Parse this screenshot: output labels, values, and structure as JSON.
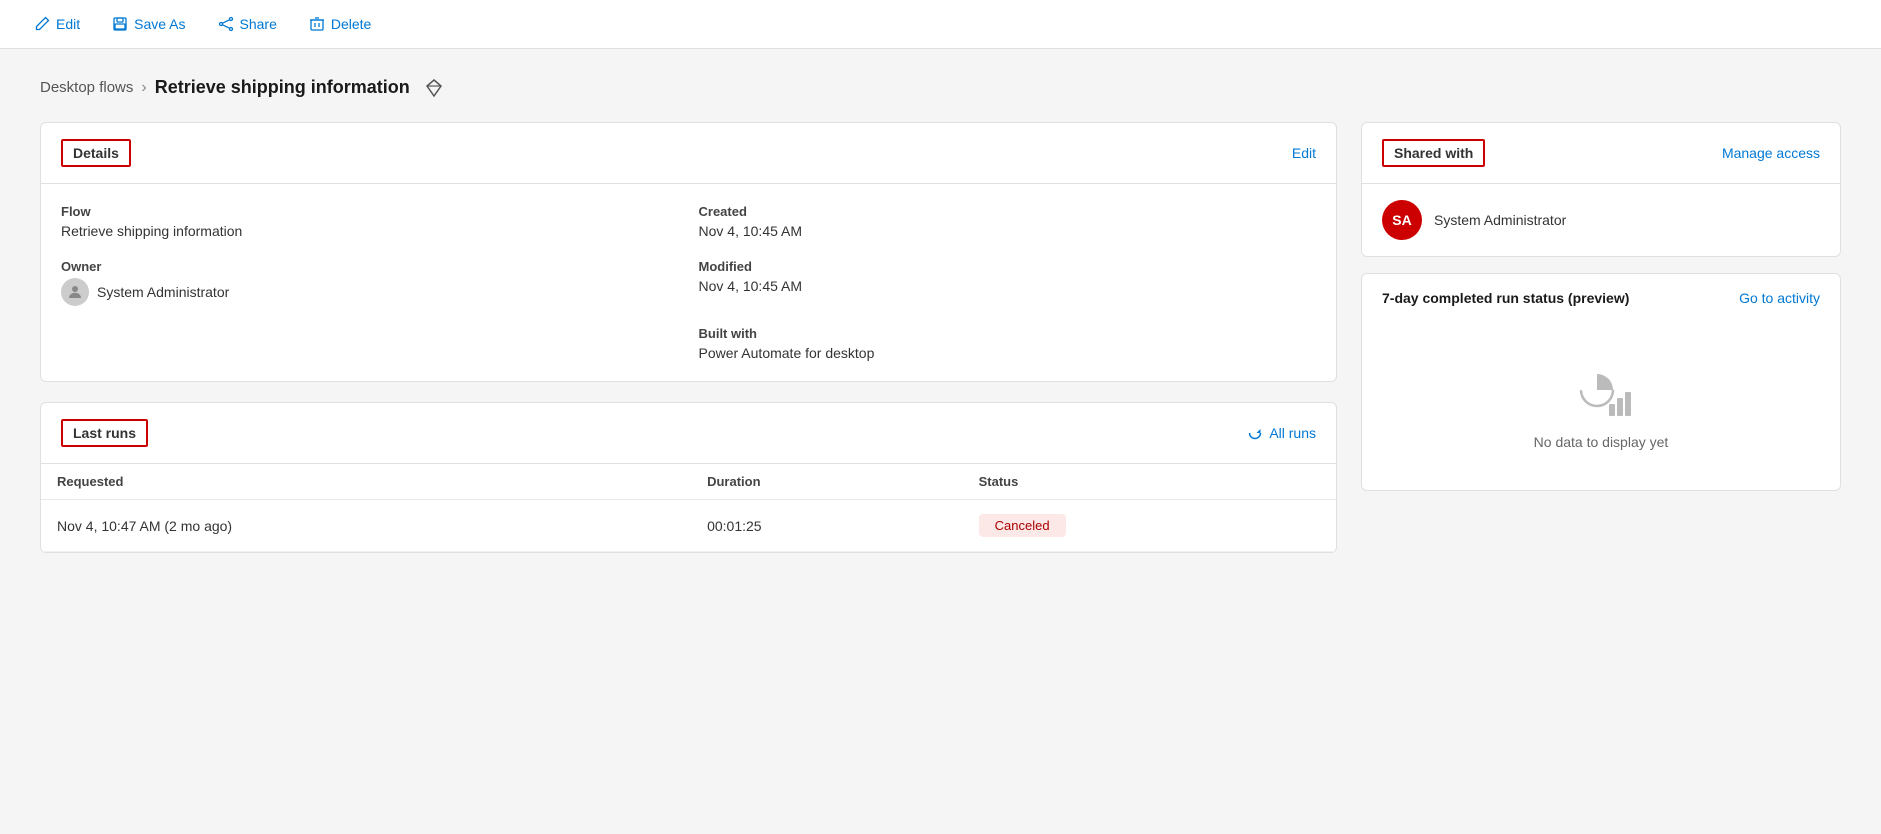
{
  "toolbar": {
    "edit_label": "Edit",
    "save_as_label": "Save As",
    "share_label": "Share",
    "delete_label": "Delete"
  },
  "breadcrumb": {
    "parent_label": "Desktop flows",
    "separator": ">",
    "current_label": "Retrieve shipping information"
  },
  "details_card": {
    "title": "Details",
    "edit_label": "Edit",
    "flow_label": "Flow",
    "flow_value": "Retrieve shipping information",
    "owner_label": "Owner",
    "owner_value": "System Administrator",
    "created_label": "Created",
    "created_value": "Nov 4, 10:45 AM",
    "modified_label": "Modified",
    "modified_value": "Nov 4, 10:45 AM",
    "built_with_label": "Built with",
    "built_with_value": "Power Automate for desktop"
  },
  "last_runs_card": {
    "title": "Last runs",
    "all_runs_label": "All runs",
    "columns": {
      "requested": "Requested",
      "duration": "Duration",
      "status": "Status"
    },
    "rows": [
      {
        "requested": "Nov 4, 10:47 AM (2 mo ago)",
        "duration": "00:01:25",
        "status": "Canceled"
      }
    ]
  },
  "shared_with_card": {
    "title": "Shared with",
    "manage_access_label": "Manage access",
    "user_initials": "SA",
    "user_name": "System Administrator"
  },
  "activity_card": {
    "title": "7-day completed run status (preview)",
    "go_to_activity_label": "Go to activity",
    "no_data_label": "No data to display yet"
  }
}
